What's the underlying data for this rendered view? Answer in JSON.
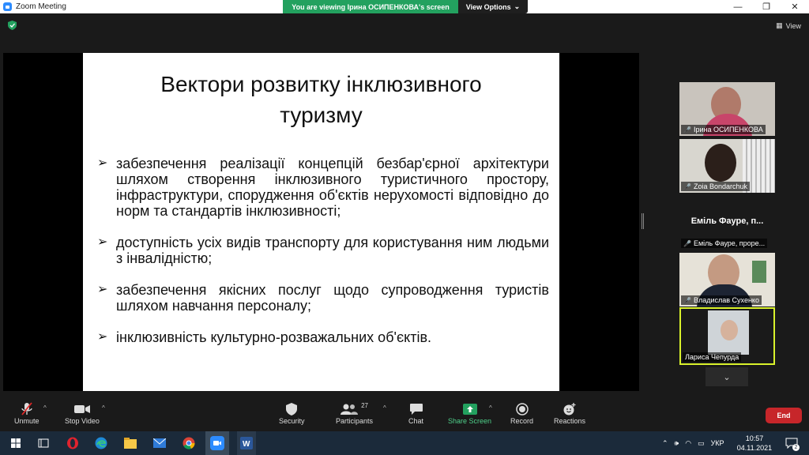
{
  "window": {
    "title": "Zoom Meeting",
    "minimize": "—",
    "restore": "❐",
    "close": "✕"
  },
  "banner": {
    "viewing": "You are viewing Ірина ОСИПЕНКОВА's screen",
    "view_options": "View Options"
  },
  "top_right": {
    "view_label": "View"
  },
  "slide": {
    "title_line1": "Вектори розвитку інклюзивного",
    "title_line2": "туризму",
    "bullets": [
      "забезпечення реалізації концепцій безбар'єрної архітектури шляхом створення інклюзивного туристичного простору, інфраструктури, спорудження об'єктів нерухомості відповідно до норм та стандартів інклюзивності;",
      "доступність усіх видів транспорту для користування ним людьми з інвалідністю;",
      "забезпечення якісних послуг щодо супроводження туристів шляхом навчання персоналу;",
      "інклюзивність культурно-розважальних об'єктів."
    ]
  },
  "participants_panel": [
    {
      "name": "Ірина ОСИПЕНКОВА",
      "muted": true
    },
    {
      "name": "Zoia Bondarchuk",
      "muted": true
    },
    {
      "name": "Еміль Фауре, проре...",
      "big_name": "Еміль Фауре, п...",
      "muted": true
    },
    {
      "name": "Владислав Сухенко",
      "muted": true
    },
    {
      "name": "Лариса Чепурда",
      "muted": false,
      "active": true
    }
  ],
  "toolbar": {
    "unmute": "Unmute",
    "stop_video": "Stop Video",
    "security": "Security",
    "participants": "Participants",
    "participants_count": "27",
    "chat": "Chat",
    "share_screen": "Share Screen",
    "record": "Record",
    "reactions": "Reactions",
    "end": "End"
  },
  "taskbar": {
    "language": "УКР",
    "time": "10:57",
    "date": "04.11.2021",
    "notifications": "2"
  },
  "colors": {
    "share_green": "#23a15f",
    "end_red": "#c7262a",
    "active_border": "#d9f22b",
    "taskbar": "#1b2a3a"
  }
}
